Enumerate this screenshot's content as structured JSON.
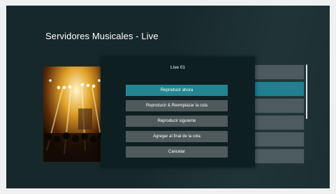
{
  "page": {
    "title": "Servidores Musicales - Live"
  },
  "dialog": {
    "title": "Live 01",
    "options": [
      {
        "label": "Reproducir ahora",
        "selected": true
      },
      {
        "label": "Reproducir & Reemplazar la cola",
        "selected": false
      },
      {
        "label": "Reproducir siguiente",
        "selected": false
      },
      {
        "label": "Agregar al final de la cola",
        "selected": false
      },
      {
        "label": "Cancelar",
        "selected": false
      }
    ]
  },
  "side_list": {
    "items": [
      "",
      "",
      "",
      "",
      "",
      ""
    ],
    "active_index": 1
  },
  "colors": {
    "screen_bg": "#17282b",
    "dialog_bg": "#0e1f22",
    "selected": "#22858f",
    "button": "#4f5a5c"
  }
}
